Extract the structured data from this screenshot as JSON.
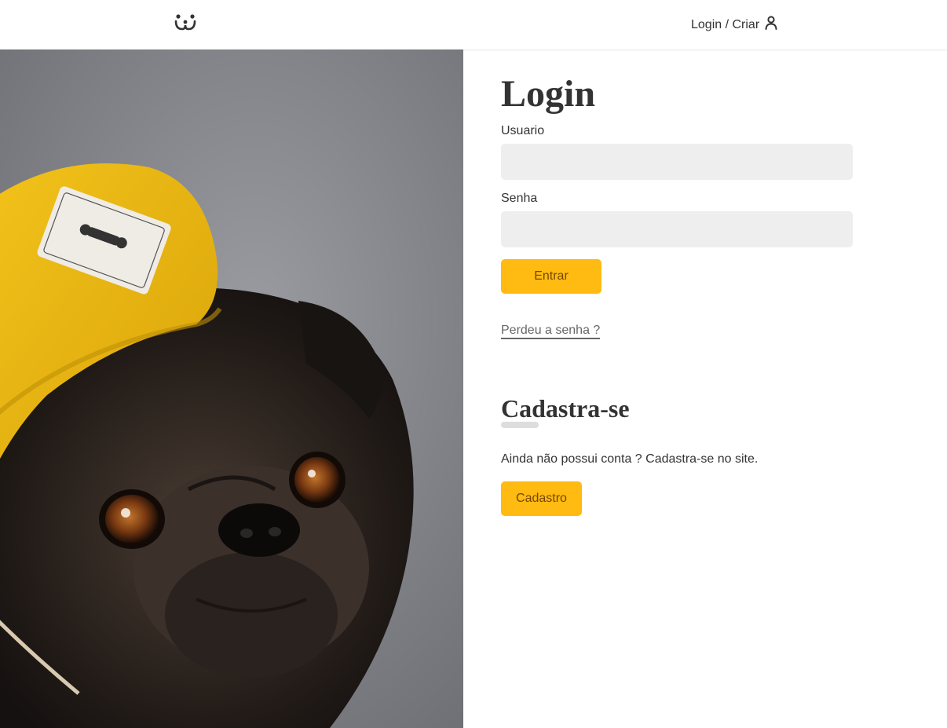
{
  "header": {
    "logo_icon": "dog-face-icon",
    "login_link": "Login / Criar",
    "user_icon": "user-icon"
  },
  "photo": {
    "description_icon": "pug-photo"
  },
  "login": {
    "title": "Login",
    "username_label": "Usuario",
    "username_value": "",
    "password_label": "Senha",
    "password_value": "",
    "submit_label": "Entrar",
    "lost_password_link": "Perdeu a senha ?"
  },
  "register": {
    "title": "Cadastra-se",
    "text": "Ainda não possui conta ? Cadastra-se no site.",
    "button_label": "Cadastro"
  },
  "colors": {
    "accent": "#ffbb11",
    "button_text": "#764701",
    "field_bg": "#eeeeee"
  }
}
